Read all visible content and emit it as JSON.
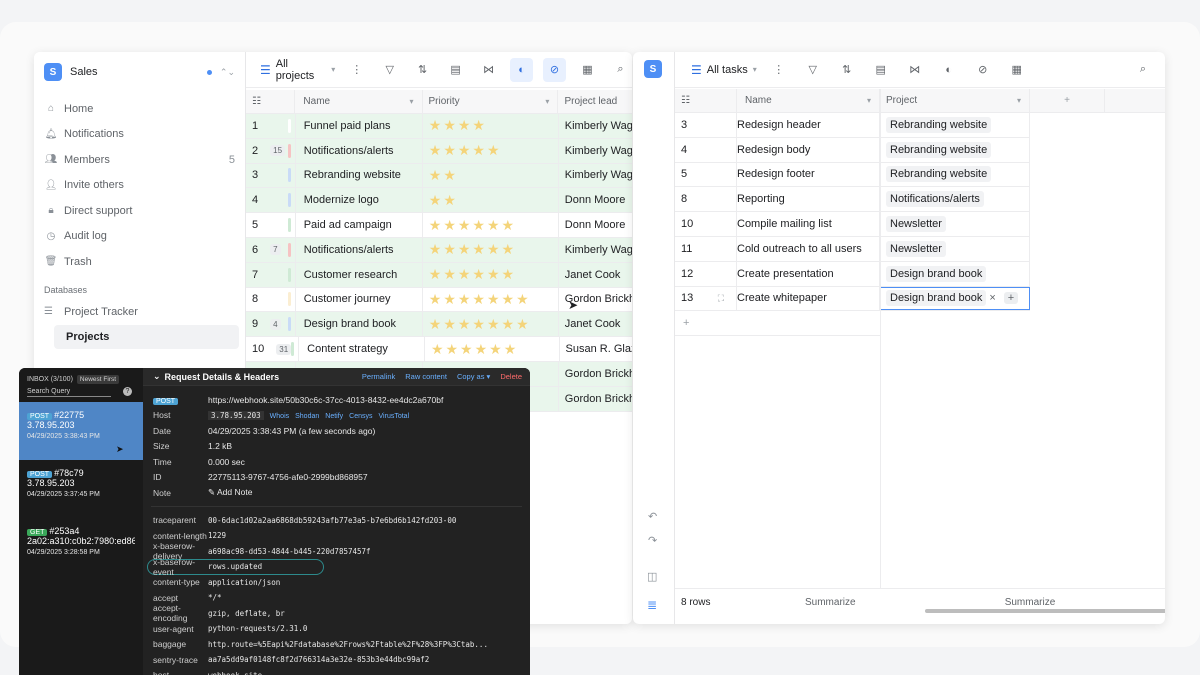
{
  "left_window": {
    "workspace": {
      "initial": "S",
      "name": "Sales"
    },
    "nav": [
      {
        "icon": "home-icon",
        "glyph": "⌂",
        "label": "Home"
      },
      {
        "icon": "bell-icon",
        "glyph": "🔔︎",
        "label": "Notifications"
      },
      {
        "icon": "members-icon",
        "glyph": "👥︎",
        "label": "Members",
        "count": "5"
      },
      {
        "icon": "invite-icon",
        "glyph": "👤︎",
        "label": "Invite others"
      },
      {
        "icon": "lock-icon",
        "glyph": "🔒︎",
        "label": "Direct support"
      },
      {
        "icon": "history-icon",
        "glyph": "◷",
        "label": "Audit log"
      },
      {
        "icon": "trash-icon",
        "glyph": "🗑︎",
        "label": "Trash"
      }
    ],
    "databases_title": "Databases",
    "database": "Project Tracker",
    "table": "Projects",
    "view_name": "All projects",
    "columns": {
      "name": "Name",
      "priority": "Priority",
      "lead": "Project lead"
    },
    "rows": [
      {
        "id": "1",
        "count": "",
        "name": "Funnel paid plans",
        "stars": 4,
        "lead": "Kimberly Wagner",
        "color": "#e9f6ec",
        "strip": "#ffffff"
      },
      {
        "id": "2",
        "count": "15",
        "name": "Notifications/alerts",
        "stars": 5,
        "lead": "Kimberly Wagner",
        "color": "#e9f6ec",
        "strip": "#f6c3c3"
      },
      {
        "id": "3",
        "count": "",
        "name": "Rebranding website",
        "stars": 2,
        "lead": "Kimberly Wagner",
        "color": "#e9f6ec",
        "strip": "#c9dbf7"
      },
      {
        "id": "4",
        "count": "",
        "name": "Modernize logo",
        "stars": 2,
        "lead": "Donn Moore",
        "color": "#e9f6ec",
        "strip": "#c9dbf7"
      },
      {
        "id": "5",
        "count": "",
        "name": "Paid ad campaign",
        "stars": 6,
        "lead": "Donn Moore",
        "color": "#ffffff",
        "strip": "#cfead5"
      },
      {
        "id": "6",
        "count": "7",
        "name": "Notifications/alerts",
        "stars": 6,
        "lead": "Kimberly Wagner",
        "color": "#e9f6ec",
        "strip": "#f6c3c3"
      },
      {
        "id": "7",
        "count": "",
        "name": "Customer research",
        "stars": 6,
        "lead": "Janet Cook",
        "color": "#e9f6ec",
        "strip": "#cfead5"
      },
      {
        "id": "8",
        "count": "",
        "name": "Customer journey",
        "stars": 7,
        "lead": "Gordon Brickhouse",
        "color": "#ffffff",
        "strip": "#fbeed2"
      },
      {
        "id": "9",
        "count": "4",
        "name": "Design brand book",
        "stars": 7,
        "lead": "Janet Cook",
        "color": "#e9f6ec",
        "strip": "#c9dbf7"
      },
      {
        "id": "10",
        "count": "31",
        "name": "Content strategy",
        "stars": 6,
        "lead": "Susan R. Glazer",
        "color": "#ffffff",
        "strip": "#cfead5"
      },
      {
        "id": "",
        "count": "",
        "name": "",
        "stars": 0,
        "lead": "Gordon Brickhouse",
        "color": "#e9f6ec",
        "strip": "#e9f6ec"
      },
      {
        "id": "",
        "count": "",
        "name": "",
        "stars": 0,
        "lead": "Gordon Brickhouse",
        "color": "#e9f6ec",
        "strip": "#e9f6ec"
      }
    ],
    "footer": {
      "summarize": "Summarize"
    }
  },
  "right_window": {
    "workspace_initial": "S",
    "view_name": "All tasks",
    "columns": {
      "name": "Name",
      "project": "Project"
    },
    "rows": [
      {
        "id": "3",
        "name": "Redesign header",
        "project": "Rebranding website"
      },
      {
        "id": "4",
        "name": "Redesign body",
        "project": "Rebranding website"
      },
      {
        "id": "5",
        "name": "Redesign footer",
        "project": "Rebranding website"
      },
      {
        "id": "8",
        "name": "Reporting",
        "project": "Notifications/alerts"
      },
      {
        "id": "10",
        "name": "Compile mailing list",
        "project": "Newsletter"
      },
      {
        "id": "11",
        "name": "Cold outreach to all users",
        "project": "Newsletter"
      },
      {
        "id": "12",
        "name": "Create presentation",
        "project": "Design brand book"
      },
      {
        "id": "13",
        "name": "Create whitepaper",
        "project": "Design brand book"
      }
    ],
    "row_count": "8 rows",
    "summarize": "Summarize"
  },
  "webhook": {
    "inbox_label": "INBOX (3/100)",
    "newest_label": "Newest First",
    "search_placeholder": "Search Query",
    "help": "?",
    "requests": [
      {
        "method": "POST",
        "id": "#22775",
        "ip": "3.78.95.203",
        "time": "04/29/2025 3:38:43 PM"
      },
      {
        "method": "POST",
        "id": "#78c79",
        "ip": "3.78.95.203",
        "time": "04/29/2025 3:37:45 PM"
      },
      {
        "method": "GET",
        "id": "#253a4",
        "ip": "2a02:a310:c0b2:7980:ed86:",
        "time": "04/29/2025 3:28:58 PM"
      }
    ],
    "detail_title": "Request Details & Headers",
    "links": [
      "Permalink",
      "Raw content",
      "Copy as ▾",
      "Delete"
    ],
    "method": "POST",
    "url": "https://webhook.site/50b30c6c-37cc-4013-8432-ee4dc2a670bf",
    "host_label": "Host",
    "host": "3.78.95.203",
    "host_links": [
      "Whois",
      "Shodan",
      "Netify",
      "Censys",
      "VirusTotal"
    ],
    "date_label": "Date",
    "date": "04/29/2025 3:38:43 PM (a few seconds ago)",
    "size_label": "Size",
    "size": "1.2 kB",
    "time_label": "Time",
    "time": "0.000 sec",
    "id_label": "ID",
    "id": "22775113-9767-4756-afe0-2999bd868957",
    "note_label": "Note",
    "add_note": "✎ Add Note",
    "headers": [
      {
        "k": "traceparent",
        "v": "00-6dac1d02a2aa6868db59243afb77e3a5-b7e6bd6b142fd203-00"
      },
      {
        "k": "content-length",
        "v": "1229"
      },
      {
        "k": "x-baserow-delivery",
        "v": "a698ac98-dd53-4844-b445-220d7857457f"
      },
      {
        "k": "x-baserow-event",
        "v": "rows.updated"
      },
      {
        "k": "content-type",
        "v": "application/json"
      },
      {
        "k": "accept",
        "v": "*/*"
      },
      {
        "k": "accept-encoding",
        "v": "gzip, deflate, br"
      },
      {
        "k": "user-agent",
        "v": "python-requests/2.31.0"
      },
      {
        "k": "baggage",
        "v": "http.route=%5Eapi%2Fdatabase%2Frows%2Ftable%2F%28%3FP%3Ctab..."
      },
      {
        "k": "sentry-trace",
        "v": "aa7a5dd9af0148fc8f2d766314a3e32e-853b3e44dbc99af2"
      },
      {
        "k": "host",
        "v": "webhook.site"
      }
    ]
  }
}
